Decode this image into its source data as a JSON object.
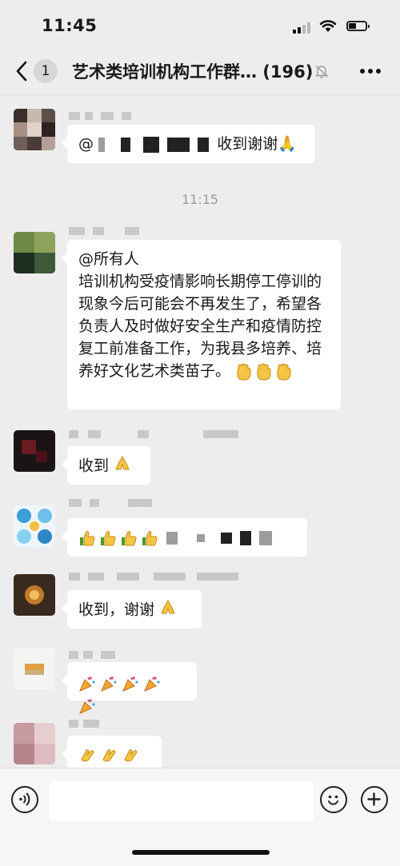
{
  "status_bar": {
    "time": "11:45"
  },
  "nav": {
    "unread_count": "1",
    "title": "艺术类培训机构工作群… (196)"
  },
  "time_divider": "11:15",
  "messages": {
    "m1": {
      "text": "收到谢谢🙏"
    },
    "m2": {
      "mention": "@所有人",
      "body": "培训机构受疫情影响长期停工停训的现象今后可能会不再发生了，希望各负责人及时做好安全生产和疫情防控复工前准备工作，为我县多培养、培养好文化艺术类苗子。"
    },
    "m3": {
      "text": "收到"
    },
    "m5": {
      "text": "收到，谢谢"
    }
  }
}
